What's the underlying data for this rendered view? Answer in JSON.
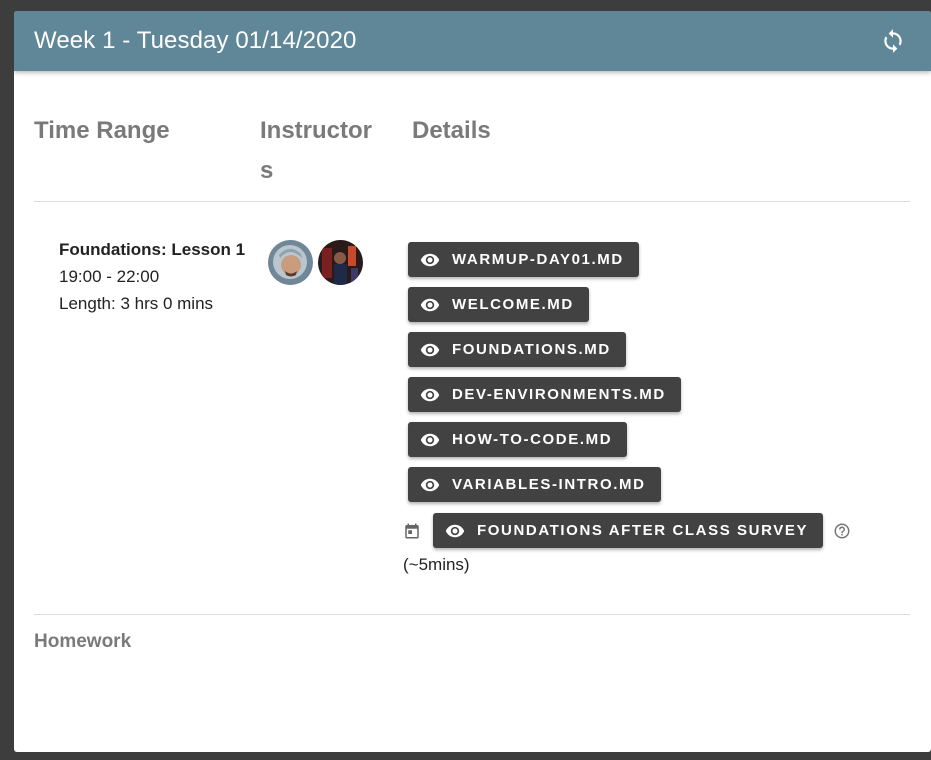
{
  "header": {
    "title": "Week 1 - Tuesday 01/14/2020",
    "icon": "refresh-icon"
  },
  "columns": {
    "time_range": "Time Range",
    "instructors_line1": "Instructor",
    "instructors_line2": "s",
    "details": "Details"
  },
  "lesson": {
    "title": "Foundations: Lesson 1",
    "time": "19:00 - 22:00",
    "length": "Length: 3 hrs 0 mins"
  },
  "materials": [
    {
      "label": "WARMUP-DAY01.MD"
    },
    {
      "label": "WELCOME.MD"
    },
    {
      "label": "FOUNDATIONS.MD"
    },
    {
      "label": "DEV-ENVIRONMENTS.MD"
    },
    {
      "label": "HOW-TO-CODE.MD"
    },
    {
      "label": "VARIABLES-INTRO.MD"
    }
  ],
  "survey": {
    "label": "FOUNDATIONS AFTER CLASS SURVEY",
    "duration": "(~5mins)"
  },
  "homework": {
    "label": "Homework"
  },
  "colors": {
    "header_bg": "#5f8797",
    "button_bg": "#424242",
    "muted_text": "#7a7a7a"
  }
}
